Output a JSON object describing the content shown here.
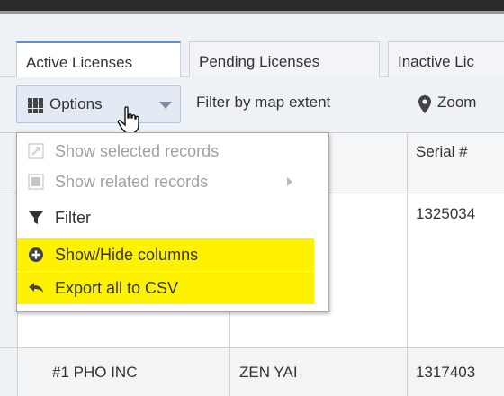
{
  "tabs": [
    {
      "label": "Active Licenses",
      "active": true
    },
    {
      "label": "Pending Licenses",
      "active": false
    },
    {
      "label": "Inactive Lic",
      "active": false
    }
  ],
  "toolbar": {
    "options_label": "Options",
    "filter_extent_label": "Filter by map extent",
    "zoom_label": "Zoom"
  },
  "options_menu": {
    "items": [
      {
        "label": "Show selected records",
        "icon": "zoom-to-selection-icon",
        "enabled": false,
        "highlighted": false
      },
      {
        "label": "Show related records",
        "icon": "related-records-icon",
        "enabled": false,
        "highlighted": false,
        "has_submenu": true
      },
      {
        "label": "Filter",
        "icon": "filter-icon",
        "enabled": true,
        "highlighted": false
      },
      {
        "label": "Show/Hide columns",
        "icon": "add-circle-icon",
        "enabled": true,
        "highlighted": true
      },
      {
        "label": "Export all to CSV",
        "icon": "export-arrow-icon",
        "enabled": true,
        "highlighted": true
      }
    ],
    "highlight_color": "#fff200"
  },
  "table": {
    "columns": [
      "Serial #"
    ],
    "rows": [
      {
        "col1": "",
        "col2": "",
        "serial": "1325034"
      },
      {
        "col1": "#1 PHO INC",
        "col2": "ZEN YAI",
        "serial": "1317403"
      }
    ]
  },
  "colors": {
    "accent": "#5b8fd6",
    "toolbar_bg": "#eef1f6",
    "text": "#333333"
  }
}
